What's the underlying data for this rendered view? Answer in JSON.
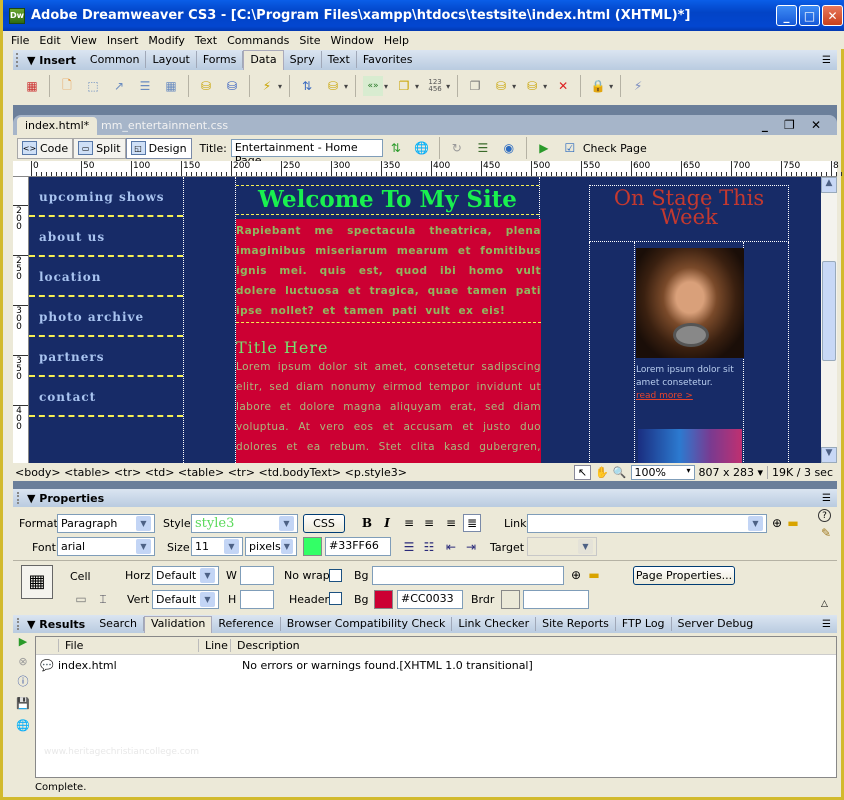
{
  "window": {
    "title": "Adobe Dreamweaver CS3 - [C:\\Program Files\\xampp\\htdocs\\testsite\\index.html (XHTML)*]",
    "app_icon": "Dw"
  },
  "menu": [
    "File",
    "Edit",
    "View",
    "Insert",
    "Modify",
    "Text",
    "Commands",
    "Site",
    "Window",
    "Help"
  ],
  "insert_bar": {
    "title": "Insert",
    "tabs": [
      "Common",
      "Layout",
      "Forms",
      "Data",
      "Spry",
      "Text",
      "Favorites"
    ],
    "active_tab": "Data",
    "icons": [
      "imported-table-data",
      "recordset",
      "dynamic-table",
      "dynamic-text",
      "master-detail",
      "insert-record",
      "update-record",
      "delete-record",
      "server-behaviors",
      "display-record-count",
      "recordset-paging",
      "show-region",
      "repeated-region",
      "go-to-detail",
      "user-authentication",
      "xslt-transformation"
    ],
    "number_icon_text": "123\n456"
  },
  "document": {
    "tabs": [
      {
        "label": "index.html*",
        "active": true
      },
      {
        "label": "mm_entertainment.css",
        "active": false
      }
    ],
    "view_buttons": [
      {
        "label": "Code",
        "active": false
      },
      {
        "label": "Split",
        "active": false
      },
      {
        "label": "Design",
        "active": true
      }
    ],
    "title_label": "Title:",
    "title_value": "Entertainment - Home Page",
    "check_page": "Check Page",
    "ruler_ticks": [
      "0",
      "50",
      "100",
      "150",
      "200",
      "250",
      "300",
      "350",
      "400",
      "450",
      "500",
      "550",
      "600",
      "650",
      "700",
      "750",
      "8"
    ],
    "vruler_ticks": [
      "200",
      "250",
      "300",
      "350",
      "400"
    ]
  },
  "page": {
    "nav": [
      "upcoming shows",
      "about us",
      "location",
      "photo archive",
      "partners",
      "contact"
    ],
    "welcome": "Welcome To My Site",
    "intro": "Rapiebant me spectacula theatrica, plena imaginibus miseriarum mearum et fomitibus ignis mei. quis est, quod ibi homo vult dolere luctuosa et tragica, quae tamen pati ipse nollet? et tamen pati vult ex eis!",
    "section_title": "Title Here",
    "lorem": "Lorem ipsum dolor sit amet, consetetur sadipscing elitr, sed diam nonumy eirmod tempor invidunt ut labore et dolore magna aliquyam erat, sed diam voluptua. At vero eos et accusam et justo duo dolores et ea rebum. Stet clita kasd gubergren, no",
    "on_stage": "On Stage This Week",
    "card_text": "Lorem ipsum dolor sit amet consetetur.",
    "read_more": "read more >"
  },
  "tag_selector": "<body> <table> <tr> <td> <table> <tr> <td.bodyText> <p.style3>",
  "status": {
    "zoom": "100%",
    "dimensions": "807 x 283",
    "size_time": "19K / 3 sec"
  },
  "properties": {
    "title": "Properties",
    "format_label": "Format",
    "format_value": "Paragraph",
    "style_label": "Style",
    "style_value": "style3",
    "css_button": "CSS",
    "link_label": "Link",
    "link_value": "",
    "font_label": "Font",
    "font_value": "arial",
    "size_label": "Size",
    "size_value": "11",
    "size_unit": "pixels",
    "text_color": "#33FF66",
    "target_label": "Target",
    "cell_label": "Cell",
    "horz_label": "Horz",
    "horz_value": "Default",
    "vert_label": "Vert",
    "vert_value": "Default",
    "w_label": "W",
    "h_label": "H",
    "nowrap_label": "No wrap",
    "header_label": "Header",
    "bg_label": "Bg",
    "bg_value": "",
    "bg2_label": "Bg",
    "bg_color": "#CC0033",
    "brdr_label": "Brdr",
    "page_properties": "Page Properties..."
  },
  "results": {
    "title": "Results",
    "tabs": [
      "Search",
      "Validation",
      "Reference",
      "Browser Compatibility Check",
      "Link Checker",
      "Site Reports",
      "FTP Log",
      "Server Debug"
    ],
    "active_tab": "Validation",
    "columns": [
      "File",
      "Line",
      "Description"
    ],
    "rows": [
      {
        "file": "index.html",
        "line": "",
        "description": "No errors or warnings found.[XHTML 1.0 transitional]"
      }
    ],
    "watermark": "www.heritagechristiancollege.com"
  },
  "statusbar": "Complete."
}
